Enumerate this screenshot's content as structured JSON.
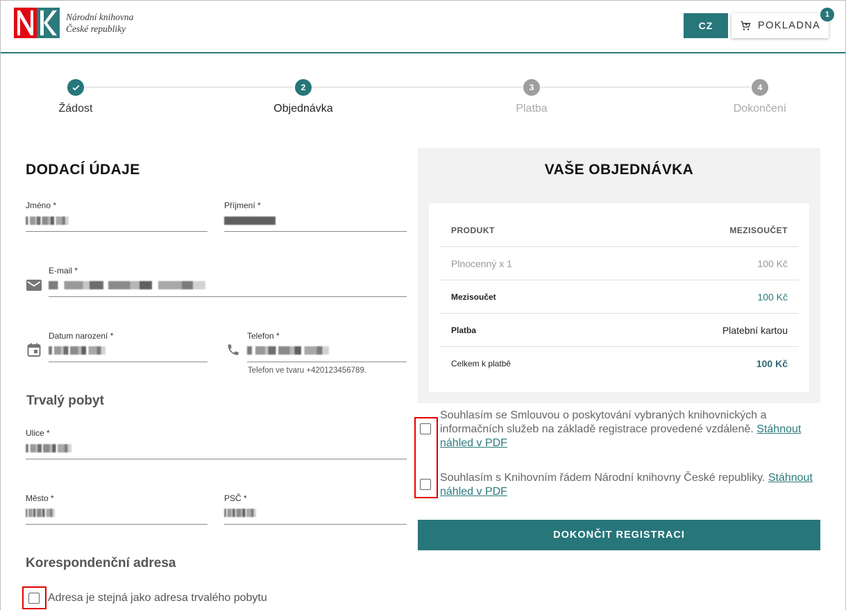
{
  "header": {
    "logo_line1": "Národní knihovna",
    "logo_line2": "České republiky",
    "lang_button": "CZ",
    "cart_button": "POKLADNA",
    "cart_count": "1"
  },
  "stepper": {
    "steps": [
      {
        "number": "✓",
        "label": "Žádost",
        "state": "done"
      },
      {
        "number": "2",
        "label": "Objednávka",
        "state": "active"
      },
      {
        "number": "3",
        "label": "Platba",
        "state": "pending"
      },
      {
        "number": "4",
        "label": "Dokončení",
        "state": "pending"
      }
    ]
  },
  "delivery": {
    "title": "DODACÍ ÚDAJE",
    "first_name_label": "Jméno *",
    "last_name_label": "Příjmení *",
    "email_label": "E-mail *",
    "birthdate_label": "Datum narození *",
    "phone_label": "Telefon *",
    "phone_hint": "Telefon ve tvaru +420123456789.",
    "residence_title": "Trvalý pobyt",
    "street_label": "Ulice *",
    "city_label": "Město *",
    "zip_label": "PSČ *",
    "correspondence_title": "Korespondenční adresa",
    "same_address_label": "Adresa je stejná jako adresa trvalého pobytu"
  },
  "order": {
    "title": "VAŠE OBJEDNÁVKA",
    "col_product": "PRODUKT",
    "col_subtotal": "MEZISOUČET",
    "item_name": "Plnocenný x 1",
    "item_price": "100 Kč",
    "subtotal_label": "Mezisoučet",
    "subtotal_value": "100 Kč",
    "payment_label": "Platba",
    "payment_value": "Platební kartou",
    "total_label": "Celkem k platbě",
    "total_value": "100 Kč"
  },
  "consents": {
    "agreement_text": "Souhlasím se Smlouvou o poskytování vybraných knihovnických a informačních služeb na základě registrace provedené vzdáleně.",
    "agreement_link": "Stáhnout náhled v PDF",
    "rules_text": "Souhlasím s Knihovním řádem Národní knihovny České republiky.",
    "rules_link": "Stáhnout náhled v PDF"
  },
  "finish_button": "DOKONČIT REGISTRACI",
  "colors": {
    "accent": "#27767a",
    "highlight": "#e10000",
    "logo_red": "#e30613"
  }
}
